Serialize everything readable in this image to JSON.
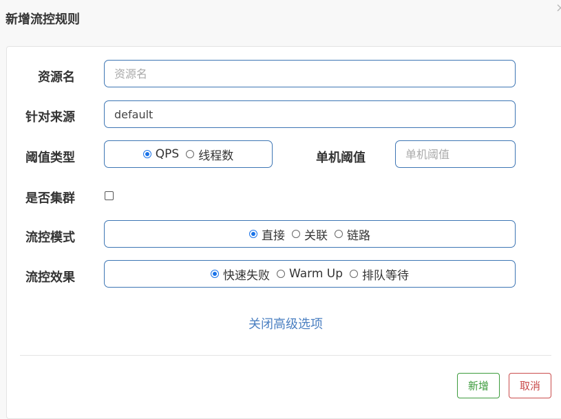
{
  "dialog": {
    "title": "新增流控规则",
    "close_glyph": "×"
  },
  "form": {
    "resource": {
      "label": "资源名",
      "value": "",
      "placeholder": "资源名"
    },
    "limit_app": {
      "label": "针对来源",
      "value": "default",
      "placeholder": ""
    },
    "grade": {
      "label": "阈值类型",
      "options": [
        "QPS",
        "线程数"
      ],
      "selected": "QPS"
    },
    "count": {
      "label": "单机阈值",
      "value": "",
      "placeholder": "单机阈值"
    },
    "cluster": {
      "label": "是否集群",
      "checked": false
    },
    "strategy": {
      "label": "流控模式",
      "options": [
        "直接",
        "关联",
        "链路"
      ],
      "selected": "直接"
    },
    "control_behavior": {
      "label": "流控效果",
      "options": [
        "快速失败",
        "Warm Up",
        "排队等待"
      ],
      "selected": "快速失败"
    },
    "advanced_toggle": "关闭高级选项"
  },
  "footer": {
    "add_label": "新增",
    "cancel_label": "取消"
  },
  "colors": {
    "accent": "#1a73e8",
    "border": "#3b74b3",
    "link": "#4a7fc1",
    "add": "#3a9a3a",
    "cancel": "#c94a4a"
  }
}
